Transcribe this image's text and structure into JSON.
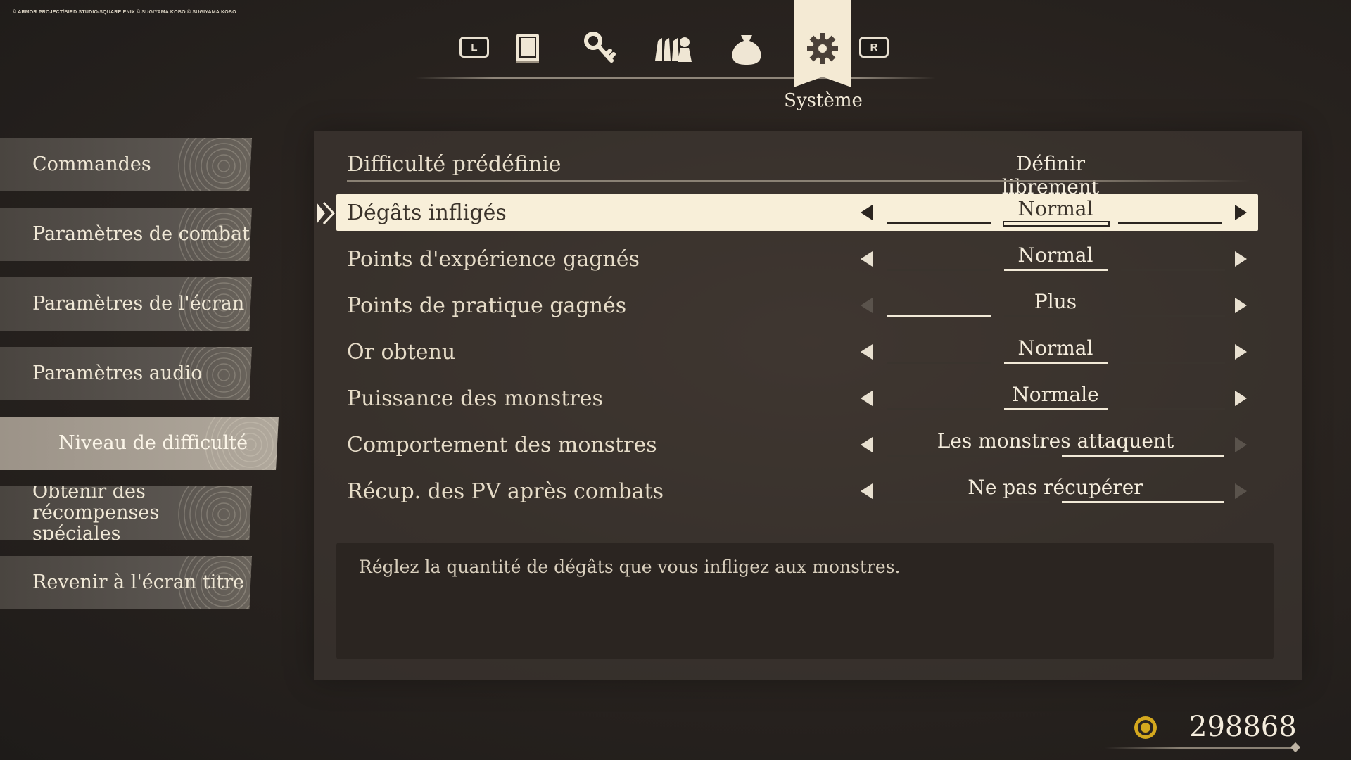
{
  "copyright": "© ARMOR PROJECT/BIRD STUDIO/SQUARE ENIX © SUGIYAMA KOBO © SUGIYAMA KOBO",
  "nav": {
    "left_button": "L",
    "right_button": "R",
    "icons": [
      "book-icon",
      "key-icon",
      "party-icon",
      "bag-icon",
      "gear-icon"
    ],
    "active_label": "Système"
  },
  "sidebar": {
    "items": [
      {
        "label": "Commandes"
      },
      {
        "label": "Paramètres de combat"
      },
      {
        "label": "Paramètres de l'écran"
      },
      {
        "label": "Paramètres audio"
      },
      {
        "label": "Niveau de difficulté"
      },
      {
        "label": "Obtenir des récompenses spéciales"
      },
      {
        "label": "Revenir à l'écran titre"
      }
    ],
    "active_index": 4
  },
  "preset": {
    "label": "Difficulté prédéfinie",
    "value": "Définir librement"
  },
  "options": [
    {
      "label": "Dégâts infligés",
      "value": "Normal"
    },
    {
      "label": "Points d'expérience gagnés",
      "value": "Normal"
    },
    {
      "label": "Points de pratique gagnés",
      "value": "Plus"
    },
    {
      "label": "Or obtenu",
      "value": "Normal"
    },
    {
      "label": "Puissance des monstres",
      "value": "Normale"
    },
    {
      "label": "Comportement des monstres",
      "value": "Les monstres attaquent"
    },
    {
      "label": "Récup. des PV après combats",
      "value": "Ne pas récupérer"
    }
  ],
  "description": "Réglez la quantité de dégâts que vous infligez aux monstres.",
  "gold": {
    "value": "298868"
  },
  "colors": {
    "selected_row": "#f8efd9",
    "text": "#efe6d4",
    "gold_icon": "#d4a81e"
  }
}
